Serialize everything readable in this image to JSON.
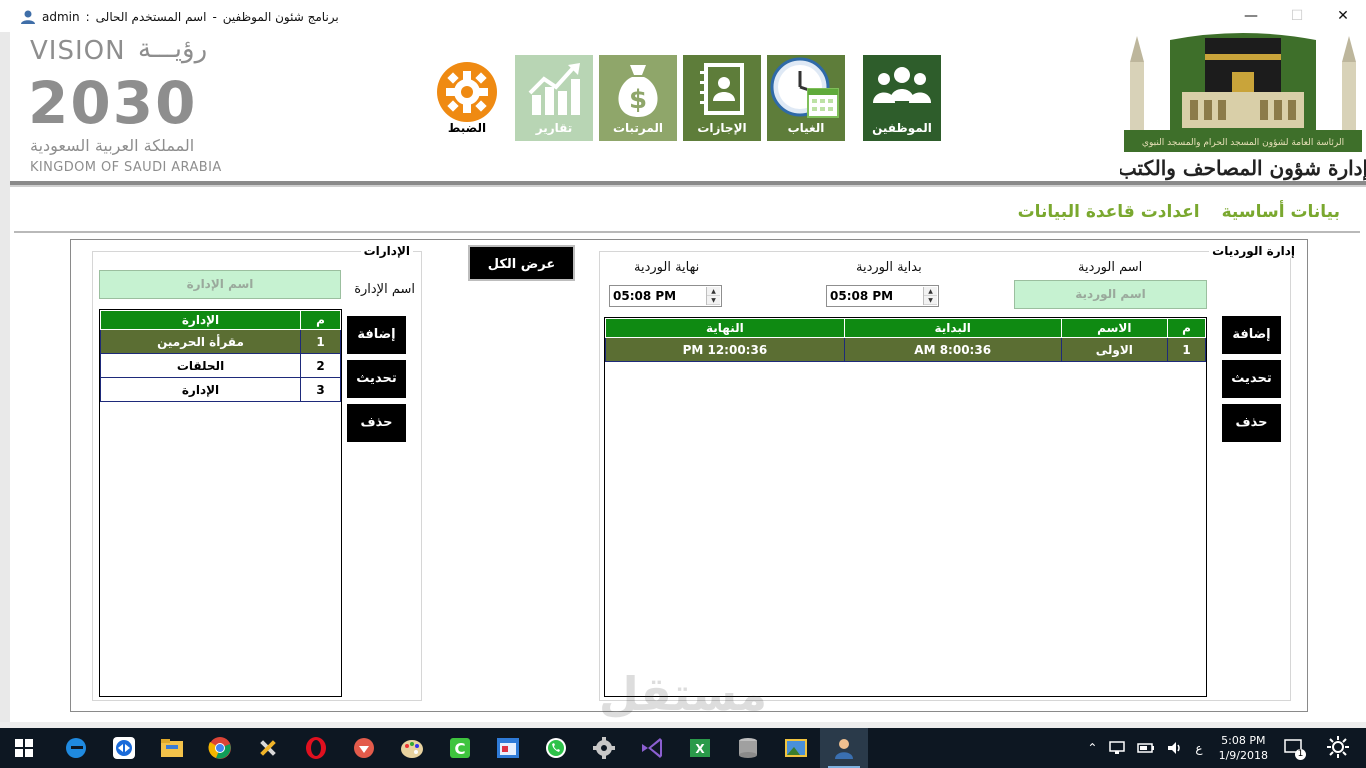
{
  "titlebar": {
    "user": "admin",
    "label_current_user": "اسم المستخدم الحالى",
    "separator": "-",
    "colon": ":",
    "app_title": "برنامج شئون الموظفين",
    "minimize": "—",
    "maximize": "☐",
    "close": "✕"
  },
  "logo": {
    "vision": "VISION",
    "vision_ar": "رؤيـــة",
    "year": "2030",
    "kingdom_ar": "المملكة العربية السعودية",
    "kingdom_en": "KINGDOM OF SAUDI ARABIA",
    "emblem_caption": "إدارة شؤون المصاحف والكتب",
    "emblem_banner": "الرئاسة العامة لشؤون المسجد الحرام والمسجد النبوي"
  },
  "nav": {
    "settings": "الضبط",
    "reports": "تقارير",
    "salaries": "المرتبات",
    "leaves": "الإجازات",
    "absence": "الغياب",
    "employees": "الموظفين"
  },
  "tabs": {
    "basic_data": "بيانات أساسية",
    "db_settings": "اعدادت قاعدة البيانات"
  },
  "departments": {
    "title": "الإدارات",
    "field_label": "اسم الإدارة",
    "placeholder": "اسم الإدارة",
    "show_all": "عرض الكل",
    "add": "إضافة",
    "update": "تحديث",
    "delete": "حذف",
    "columns": [
      "م",
      "الإدارة"
    ],
    "rows": [
      {
        "n": "1",
        "name": "مقرأة الحرمين"
      },
      {
        "n": "2",
        "name": "الحلقات"
      },
      {
        "n": "3",
        "name": "الإدارة"
      }
    ]
  },
  "shifts": {
    "title": "إدارة الورديات",
    "name_label": "اسم الوردية",
    "name_placeholder": "اسم الوردية",
    "start_label": "بداية الوردية",
    "end_label": "نهاية الوردية",
    "start_value": "05:08 PM",
    "end_value": "05:08 PM",
    "add": "إضافة",
    "update": "تحديث",
    "delete": "حذف",
    "columns": [
      "م",
      "الاسم",
      "البداية",
      "النهاية"
    ],
    "rows": [
      {
        "n": "1",
        "name": "الاولى",
        "start": "AM 8:00:36",
        "end": "PM 12:00:36"
      }
    ]
  },
  "watermark": {
    "ar": "مستقل",
    "en": "mostaql.com"
  },
  "taskbar": {
    "lang": "ع",
    "time": "5:08 PM",
    "date": "1/9/2018",
    "notifications": "1"
  }
}
